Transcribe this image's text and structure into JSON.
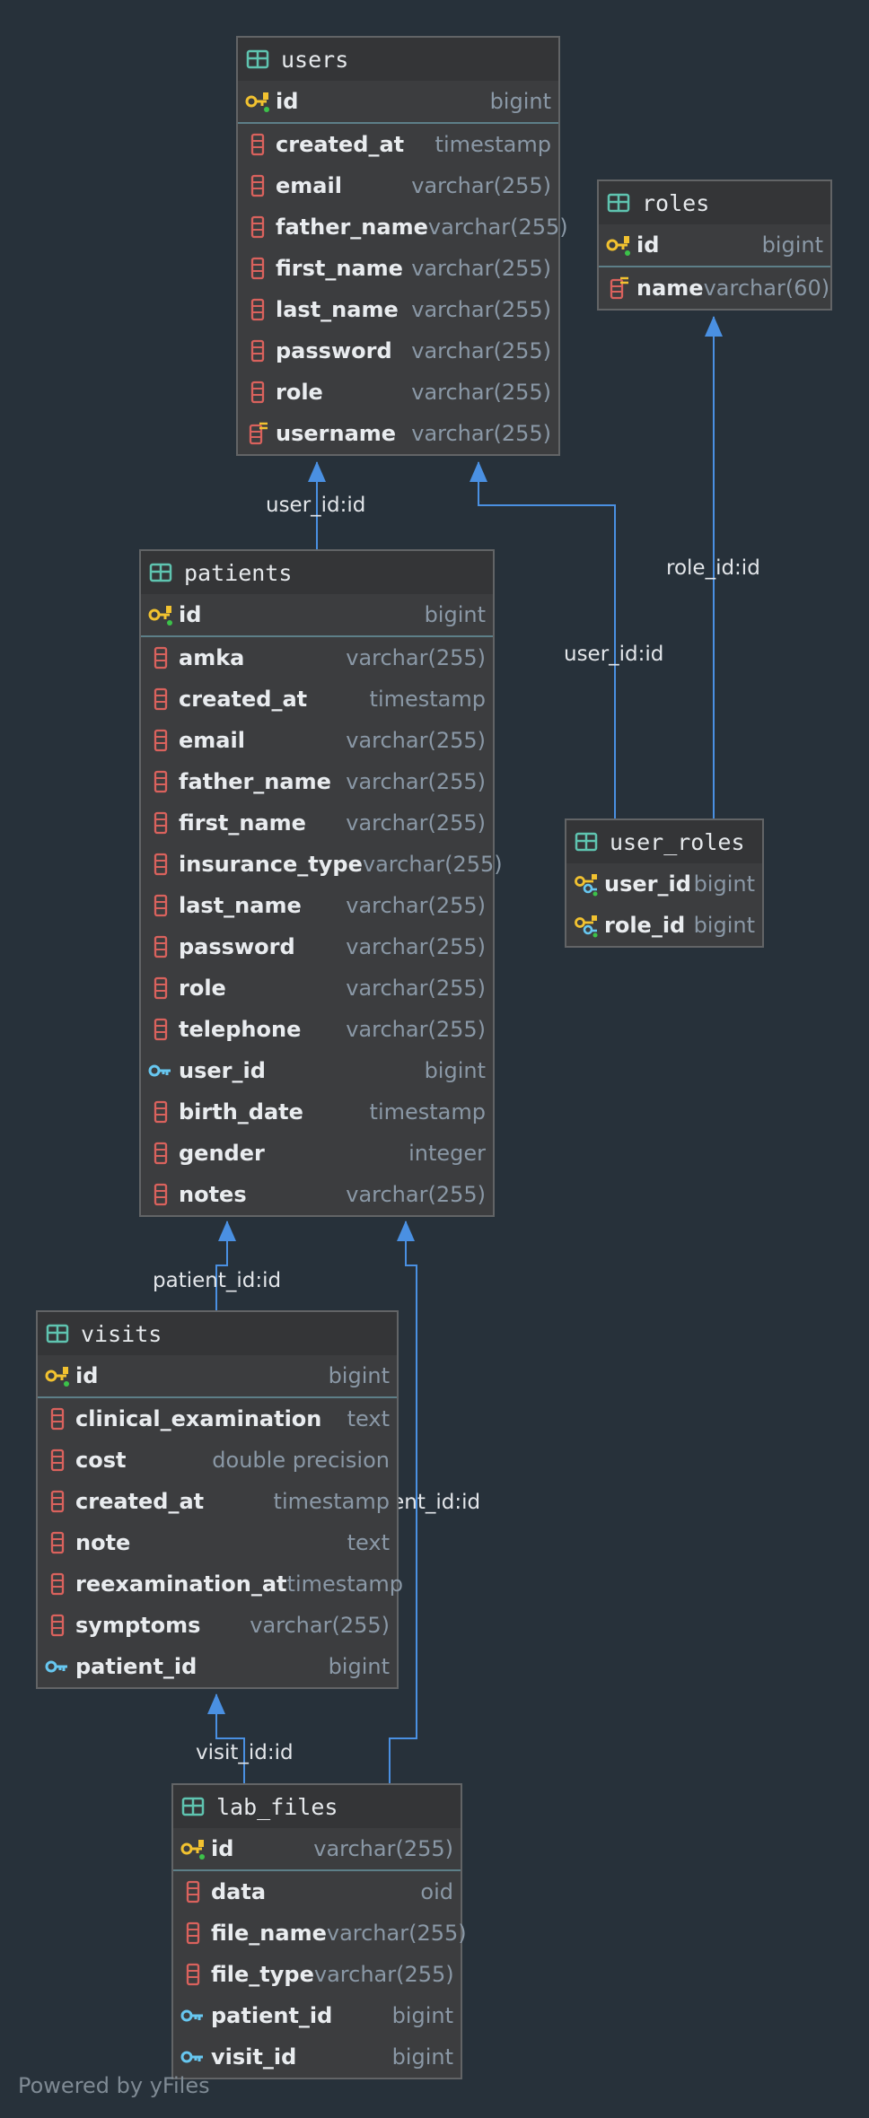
{
  "footer": "Powered by yFiles",
  "colors": {
    "background": "#27313a",
    "edge": "#4a90e2",
    "table_border": "#626466",
    "pk_divider": "#5d7f88"
  },
  "tables": {
    "users": {
      "name": "users",
      "pk": {
        "name": "id",
        "type": "bigint"
      },
      "columns": [
        {
          "name": "created_at",
          "type": "timestamp",
          "icon": "column-icon"
        },
        {
          "name": "email",
          "type": "varchar(255)",
          "icon": "column-icon"
        },
        {
          "name": "father_name",
          "type": "varchar(255)",
          "icon": "column-icon"
        },
        {
          "name": "first_name",
          "type": "varchar(255)",
          "icon": "column-icon"
        },
        {
          "name": "last_name",
          "type": "varchar(255)",
          "icon": "column-icon"
        },
        {
          "name": "password",
          "type": "varchar(255)",
          "icon": "column-icon"
        },
        {
          "name": "role",
          "type": "varchar(255)",
          "icon": "column-icon"
        },
        {
          "name": "username",
          "type": "varchar(255)",
          "icon": "unique-column-icon"
        }
      ]
    },
    "roles": {
      "name": "roles",
      "pk": {
        "name": "id",
        "type": "bigint"
      },
      "columns": [
        {
          "name": "name",
          "type": "varchar(60)",
          "icon": "unique-column-icon"
        }
      ]
    },
    "patients": {
      "name": "patients",
      "pk": {
        "name": "id",
        "type": "bigint"
      },
      "columns": [
        {
          "name": "amka",
          "type": "varchar(255)",
          "icon": "column-icon"
        },
        {
          "name": "created_at",
          "type": "timestamp",
          "icon": "column-icon"
        },
        {
          "name": "email",
          "type": "varchar(255)",
          "icon": "column-icon"
        },
        {
          "name": "father_name",
          "type": "varchar(255)",
          "icon": "column-icon"
        },
        {
          "name": "first_name",
          "type": "varchar(255)",
          "icon": "column-icon"
        },
        {
          "name": "insurance_type",
          "type": "varchar(255)",
          "icon": "column-icon"
        },
        {
          "name": "last_name",
          "type": "varchar(255)",
          "icon": "column-icon"
        },
        {
          "name": "password",
          "type": "varchar(255)",
          "icon": "column-icon"
        },
        {
          "name": "role",
          "type": "varchar(255)",
          "icon": "column-icon"
        },
        {
          "name": "telephone",
          "type": "varchar(255)",
          "icon": "column-icon"
        },
        {
          "name": "user_id",
          "type": "bigint",
          "icon": "foreign-key-icon"
        },
        {
          "name": "birth_date",
          "type": "timestamp",
          "icon": "column-icon"
        },
        {
          "name": "gender",
          "type": "integer",
          "icon": "column-icon"
        },
        {
          "name": "notes",
          "type": "varchar(255)",
          "icon": "column-icon"
        }
      ]
    },
    "user_roles": {
      "name": "user_roles",
      "columns": [
        {
          "name": "user_id",
          "type": "bigint",
          "icon": "composite-key-icon"
        },
        {
          "name": "role_id",
          "type": "bigint",
          "icon": "composite-key-icon"
        }
      ]
    },
    "visits": {
      "name": "visits",
      "pk": {
        "name": "id",
        "type": "bigint"
      },
      "columns": [
        {
          "name": "clinical_examination",
          "type": "text",
          "icon": "column-icon"
        },
        {
          "name": "cost",
          "type": "double precision",
          "icon": "column-icon"
        },
        {
          "name": "created_at",
          "type": "timestamp",
          "icon": "column-icon"
        },
        {
          "name": "note",
          "type": "text",
          "icon": "column-icon"
        },
        {
          "name": "reexamination_at",
          "type": "timestamp",
          "icon": "column-icon"
        },
        {
          "name": "symptoms",
          "type": "varchar(255)",
          "icon": "column-icon"
        },
        {
          "name": "patient_id",
          "type": "bigint",
          "icon": "foreign-key-icon"
        }
      ]
    },
    "lab_files": {
      "name": "lab_files",
      "pk": {
        "name": "id",
        "type": "varchar(255)"
      },
      "columns": [
        {
          "name": "data",
          "type": "oid",
          "icon": "column-icon"
        },
        {
          "name": "file_name",
          "type": "varchar(255)",
          "icon": "column-icon"
        },
        {
          "name": "file_type",
          "type": "varchar(255)",
          "icon": "column-icon"
        },
        {
          "name": "patient_id",
          "type": "bigint",
          "icon": "foreign-key-icon"
        },
        {
          "name": "visit_id",
          "type": "bigint",
          "icon": "foreign-key-icon"
        }
      ]
    }
  },
  "relations": [
    {
      "from": "patients",
      "to": "users",
      "label": "user_id:id"
    },
    {
      "from": "user_roles",
      "to": "users",
      "label": "user_id:id"
    },
    {
      "from": "user_roles",
      "to": "roles",
      "label": "role_id:id"
    },
    {
      "from": "visits",
      "to": "patients",
      "label": "patient_id:id"
    },
    {
      "from": "lab_files",
      "to": "patients",
      "label": "patient_id:id"
    },
    {
      "from": "lab_files",
      "to": "visits",
      "label": "visit_id:id"
    }
  ]
}
